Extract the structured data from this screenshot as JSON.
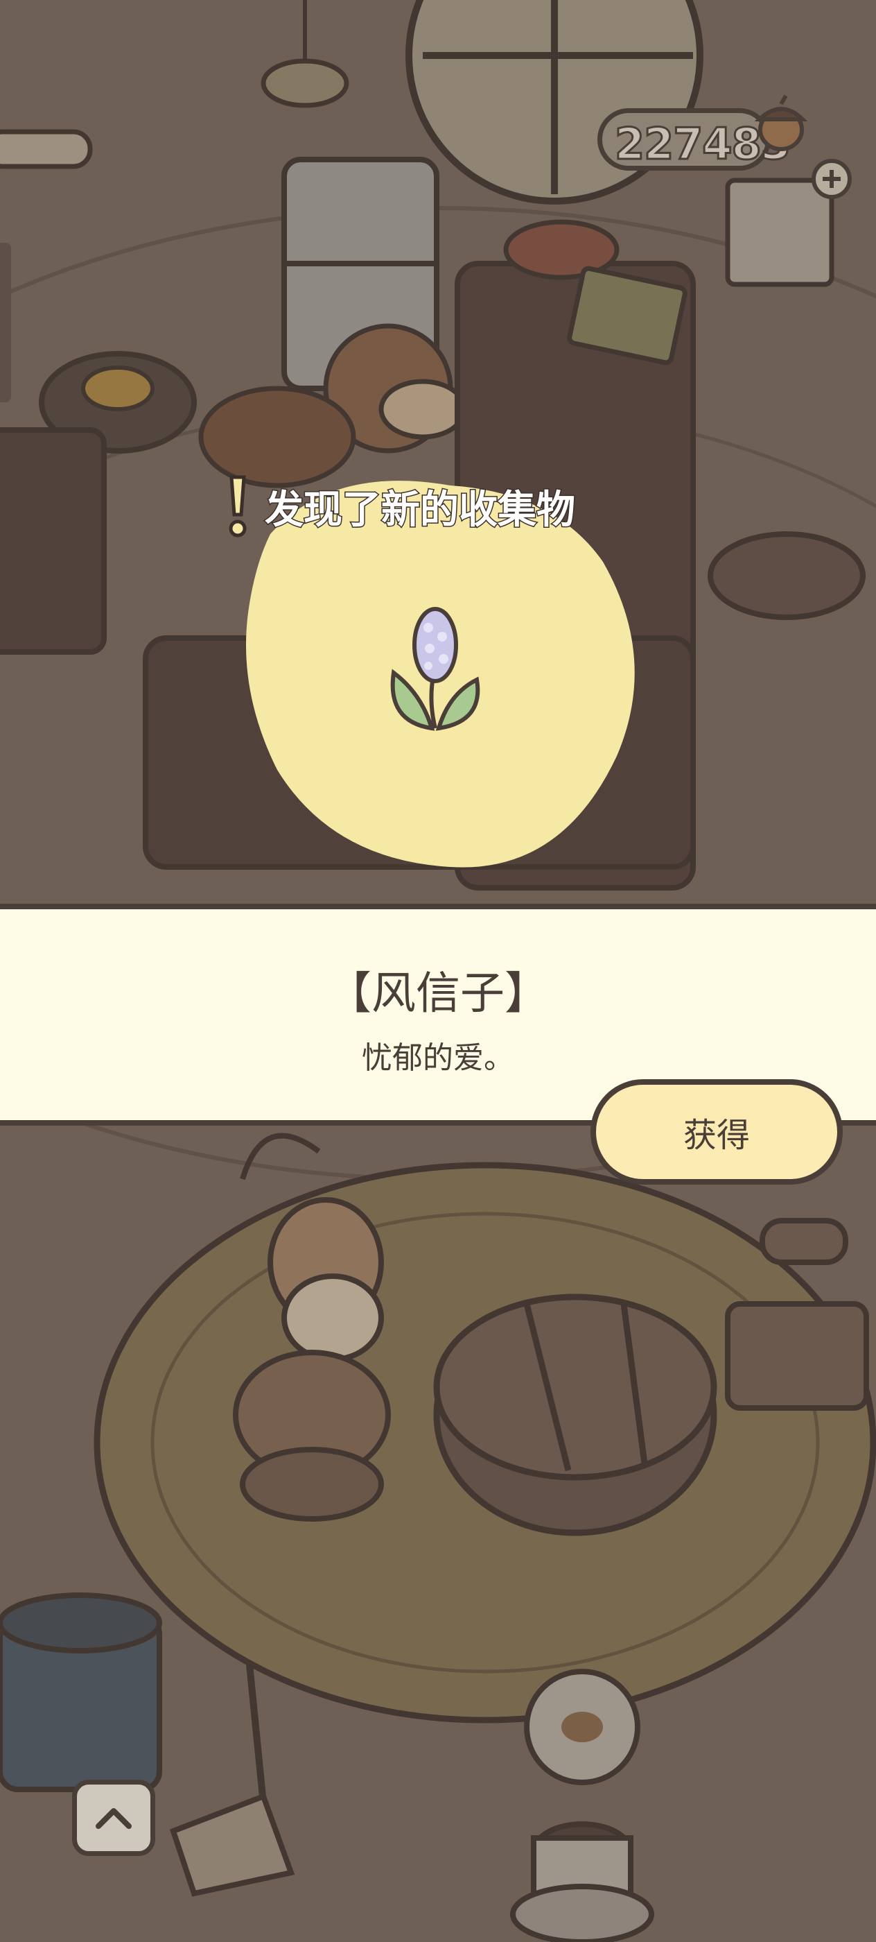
{
  "hud": {
    "coin_count": "227483",
    "coin_icon": "acorn-icon",
    "add_icon": "plus-icon"
  },
  "discovery": {
    "title": "发现了新的收集物",
    "item_icon": "hyacinth-flower-icon"
  },
  "item_card": {
    "name": "【风信子】",
    "description": "忧郁的爱。"
  },
  "actions": {
    "obtain_label": "获得",
    "scroll_up_icon": "chevron-up-icon"
  },
  "colors": {
    "banner_bg": "#fefbe6",
    "button_bg": "#fcebb3",
    "highlight_blob": "#f6e9a6",
    "outline": "#4a3e38"
  }
}
